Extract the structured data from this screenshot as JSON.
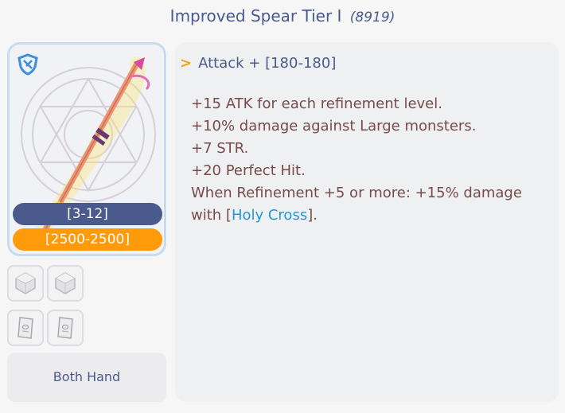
{
  "header": {
    "title": "Improved Spear Tier I",
    "item_id": "(8919)"
  },
  "card": {
    "class_icon": "shield-icon",
    "level_range": "[3-12]",
    "price_range": "[2500-2500]"
  },
  "slots": [
    {
      "icon": "card-slot-gem-icon"
    },
    {
      "icon": "card-slot-gem-icon"
    },
    {
      "icon": "card-slot-scroll-icon"
    },
    {
      "icon": "card-slot-scroll-icon"
    }
  ],
  "equip": {
    "hand_label": "Both Hand"
  },
  "description": {
    "attack_arrow": ">",
    "attack_line": "Attack + [180-180]",
    "lines": [
      "+15 ATK for each refinement level.",
      "+10% damage against Large monsters.",
      "+7 STR.",
      "+20 Perfect Hit.",
      "When Refinement +5 or more: +15% damage"
    ],
    "last_line_prefix": "with [",
    "skill_name": "Holy Cross",
    "last_line_suffix": "]."
  },
  "colors": {
    "title": "#4a5a8c",
    "level_pill": "#4a5a8c",
    "price_pill": "#ff9a0a",
    "desc_text": "#7a4a4a",
    "skill_link": "#1f98d6",
    "arrow": "#f0a020"
  }
}
